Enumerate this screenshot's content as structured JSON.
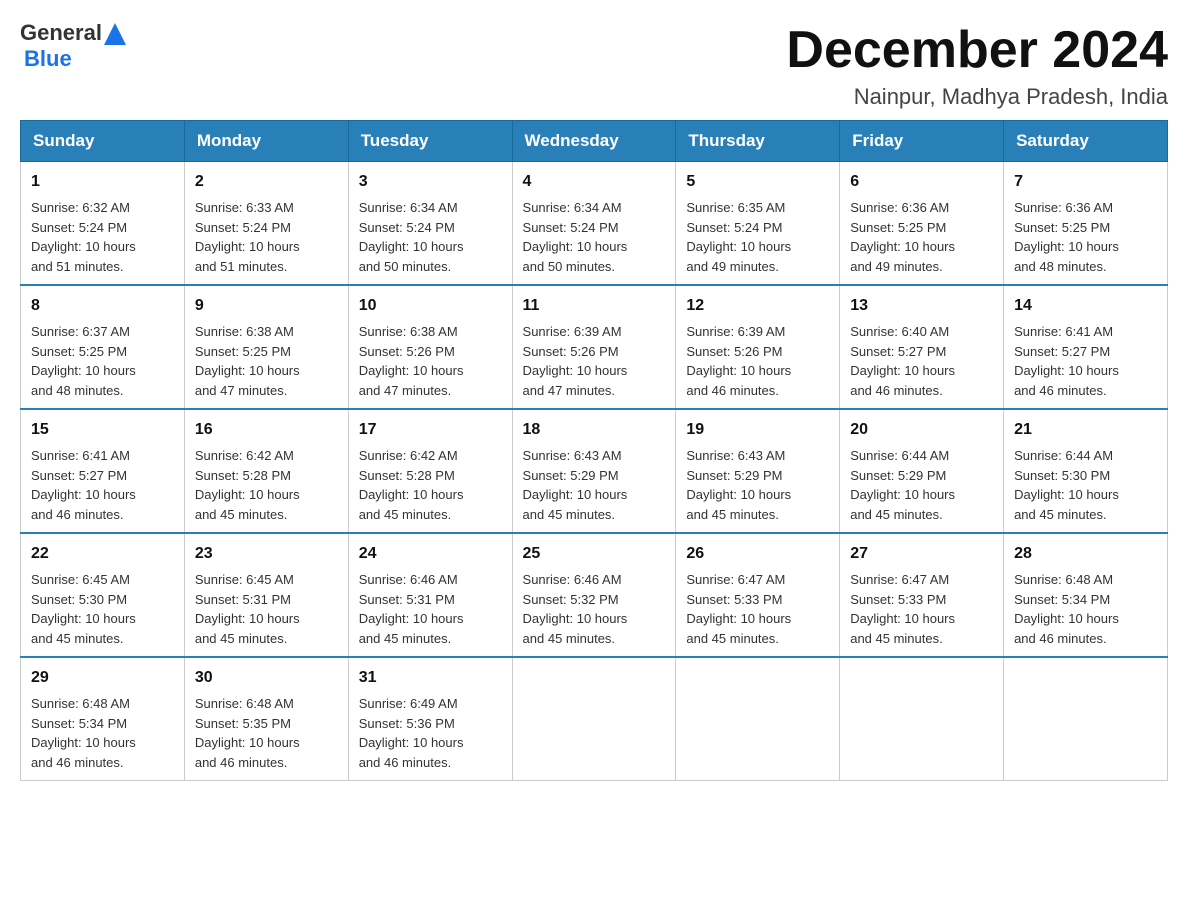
{
  "header": {
    "logo_general": "General",
    "logo_blue": "Blue",
    "title": "December 2024",
    "subtitle": "Nainpur, Madhya Pradesh, India"
  },
  "days_of_week": [
    "Sunday",
    "Monday",
    "Tuesday",
    "Wednesday",
    "Thursday",
    "Friday",
    "Saturday"
  ],
  "weeks": [
    [
      {
        "day": "1",
        "sunrise": "6:32 AM",
        "sunset": "5:24 PM",
        "daylight": "10 hours and 51 minutes."
      },
      {
        "day": "2",
        "sunrise": "6:33 AM",
        "sunset": "5:24 PM",
        "daylight": "10 hours and 51 minutes."
      },
      {
        "day": "3",
        "sunrise": "6:34 AM",
        "sunset": "5:24 PM",
        "daylight": "10 hours and 50 minutes."
      },
      {
        "day": "4",
        "sunrise": "6:34 AM",
        "sunset": "5:24 PM",
        "daylight": "10 hours and 50 minutes."
      },
      {
        "day": "5",
        "sunrise": "6:35 AM",
        "sunset": "5:24 PM",
        "daylight": "10 hours and 49 minutes."
      },
      {
        "day": "6",
        "sunrise": "6:36 AM",
        "sunset": "5:25 PM",
        "daylight": "10 hours and 49 minutes."
      },
      {
        "day": "7",
        "sunrise": "6:36 AM",
        "sunset": "5:25 PM",
        "daylight": "10 hours and 48 minutes."
      }
    ],
    [
      {
        "day": "8",
        "sunrise": "6:37 AM",
        "sunset": "5:25 PM",
        "daylight": "10 hours and 48 minutes."
      },
      {
        "day": "9",
        "sunrise": "6:38 AM",
        "sunset": "5:25 PM",
        "daylight": "10 hours and 47 minutes."
      },
      {
        "day": "10",
        "sunrise": "6:38 AM",
        "sunset": "5:26 PM",
        "daylight": "10 hours and 47 minutes."
      },
      {
        "day": "11",
        "sunrise": "6:39 AM",
        "sunset": "5:26 PM",
        "daylight": "10 hours and 47 minutes."
      },
      {
        "day": "12",
        "sunrise": "6:39 AM",
        "sunset": "5:26 PM",
        "daylight": "10 hours and 46 minutes."
      },
      {
        "day": "13",
        "sunrise": "6:40 AM",
        "sunset": "5:27 PM",
        "daylight": "10 hours and 46 minutes."
      },
      {
        "day": "14",
        "sunrise": "6:41 AM",
        "sunset": "5:27 PM",
        "daylight": "10 hours and 46 minutes."
      }
    ],
    [
      {
        "day": "15",
        "sunrise": "6:41 AM",
        "sunset": "5:27 PM",
        "daylight": "10 hours and 46 minutes."
      },
      {
        "day": "16",
        "sunrise": "6:42 AM",
        "sunset": "5:28 PM",
        "daylight": "10 hours and 45 minutes."
      },
      {
        "day": "17",
        "sunrise": "6:42 AM",
        "sunset": "5:28 PM",
        "daylight": "10 hours and 45 minutes."
      },
      {
        "day": "18",
        "sunrise": "6:43 AM",
        "sunset": "5:29 PM",
        "daylight": "10 hours and 45 minutes."
      },
      {
        "day": "19",
        "sunrise": "6:43 AM",
        "sunset": "5:29 PM",
        "daylight": "10 hours and 45 minutes."
      },
      {
        "day": "20",
        "sunrise": "6:44 AM",
        "sunset": "5:29 PM",
        "daylight": "10 hours and 45 minutes."
      },
      {
        "day": "21",
        "sunrise": "6:44 AM",
        "sunset": "5:30 PM",
        "daylight": "10 hours and 45 minutes."
      }
    ],
    [
      {
        "day": "22",
        "sunrise": "6:45 AM",
        "sunset": "5:30 PM",
        "daylight": "10 hours and 45 minutes."
      },
      {
        "day": "23",
        "sunrise": "6:45 AM",
        "sunset": "5:31 PM",
        "daylight": "10 hours and 45 minutes."
      },
      {
        "day": "24",
        "sunrise": "6:46 AM",
        "sunset": "5:31 PM",
        "daylight": "10 hours and 45 minutes."
      },
      {
        "day": "25",
        "sunrise": "6:46 AM",
        "sunset": "5:32 PM",
        "daylight": "10 hours and 45 minutes."
      },
      {
        "day": "26",
        "sunrise": "6:47 AM",
        "sunset": "5:33 PM",
        "daylight": "10 hours and 45 minutes."
      },
      {
        "day": "27",
        "sunrise": "6:47 AM",
        "sunset": "5:33 PM",
        "daylight": "10 hours and 45 minutes."
      },
      {
        "day": "28",
        "sunrise": "6:48 AM",
        "sunset": "5:34 PM",
        "daylight": "10 hours and 46 minutes."
      }
    ],
    [
      {
        "day": "29",
        "sunrise": "6:48 AM",
        "sunset": "5:34 PM",
        "daylight": "10 hours and 46 minutes."
      },
      {
        "day": "30",
        "sunrise": "6:48 AM",
        "sunset": "5:35 PM",
        "daylight": "10 hours and 46 minutes."
      },
      {
        "day": "31",
        "sunrise": "6:49 AM",
        "sunset": "5:36 PM",
        "daylight": "10 hours and 46 minutes."
      },
      null,
      null,
      null,
      null
    ]
  ],
  "labels": {
    "sunrise": "Sunrise:",
    "sunset": "Sunset:",
    "daylight": "Daylight:"
  }
}
